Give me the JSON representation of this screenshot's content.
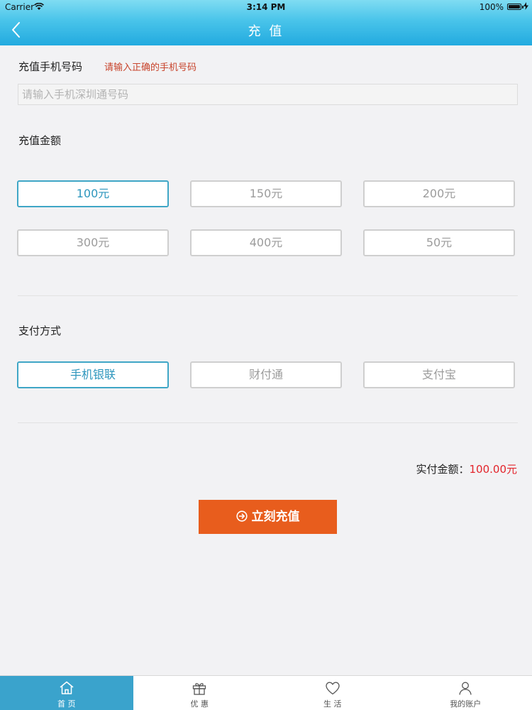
{
  "status_bar": {
    "carrier": "Carrier",
    "time": "3:14 PM",
    "battery": "100%"
  },
  "nav": {
    "title": "充 值"
  },
  "phone": {
    "label": "充值手机号码",
    "hint": "请输入正确的手机号码",
    "placeholder": "请输入手机深圳通号码"
  },
  "amount": {
    "label": "充值金额",
    "options": [
      "100元",
      "150元",
      "200元",
      "300元",
      "400元",
      "50元"
    ],
    "selected": "100元"
  },
  "payment": {
    "label": "支付方式",
    "options": [
      "手机银联",
      "财付通",
      "支付宝"
    ],
    "selected": "手机银联"
  },
  "summary": {
    "label": "实付金额：",
    "value": "100.00元"
  },
  "submit": {
    "label": "立刻充值"
  },
  "tabs": [
    {
      "label": "首 页",
      "icon": "home-icon",
      "active": true
    },
    {
      "label": "优 惠",
      "icon": "gift-icon",
      "active": false
    },
    {
      "label": "生 活",
      "icon": "heart-icon",
      "active": false
    },
    {
      "label": "我的账户",
      "icon": "user-icon",
      "active": false
    }
  ],
  "colors": {
    "header_top": "#7fdcf2",
    "header_bottom": "#22aadf",
    "selected_border": "#3fa6c6",
    "hint_text": "#c8442c",
    "price_text": "#e3242b",
    "button_bg": "#e85d1d",
    "active_tab_bg": "#3aa3cc"
  }
}
